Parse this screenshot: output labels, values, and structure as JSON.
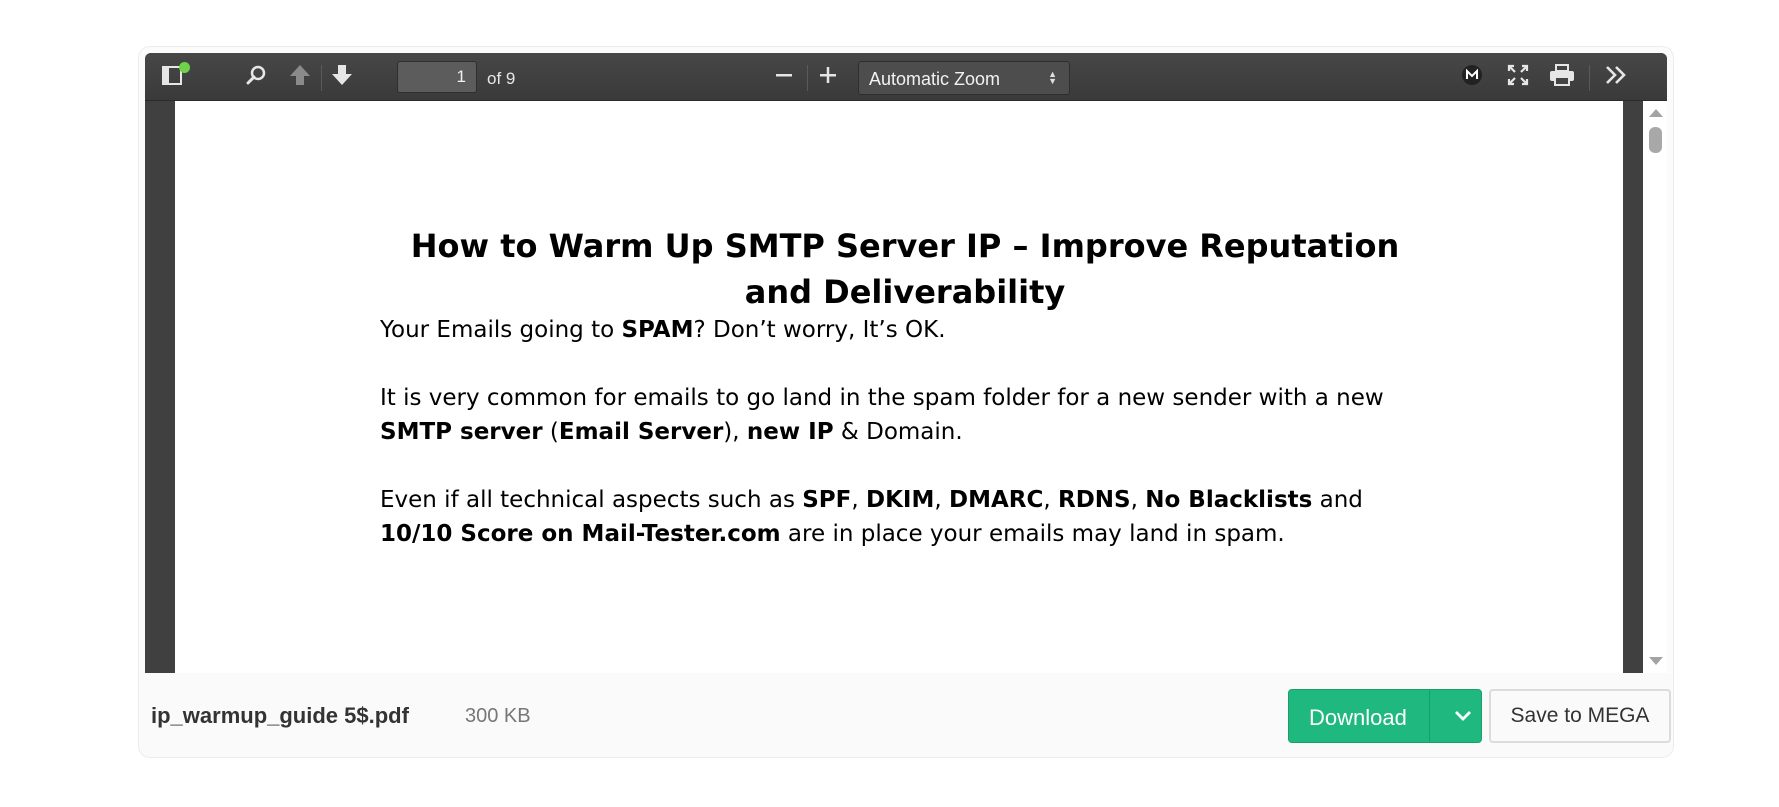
{
  "toolbar": {
    "page_number": "1",
    "page_of": "of 9",
    "zoom_value": "Automatic Zoom"
  },
  "icons": {
    "sidebar": "sidebar-toggle-icon",
    "search": "search-icon",
    "prev": "arrow-up-icon",
    "next": "arrow-down-icon",
    "zoom_out": "minus-icon",
    "zoom_in": "plus-icon",
    "mega": "mega-logo-icon",
    "fullscreen": "fullscreen-icon",
    "print": "print-icon",
    "more": "double-chevron-right-icon"
  },
  "colors": {
    "toolbar_bg": "#404040",
    "download_green": "#1fb87f",
    "notification_dot": "#6fd34a"
  },
  "document": {
    "title": "How to Warm Up SMTP Server IP – Improve Reputation and Deliverability",
    "p1": {
      "t1": "Your Emails going to ",
      "b1": "SPAM",
      "t2": "? Don’t worry, It’s OK."
    },
    "p2": {
      "t1": "It is very common for emails to go land in the spam folder for a new sender with a new ",
      "b1": "SMTP server",
      "t2": " (",
      "b2": "Email Server",
      "t3": "), ",
      "b3": "new IP",
      "t4": " & Domain."
    },
    "p3": {
      "t1": "Even if all technical aspects such as ",
      "b1": "SPF",
      "t2": ", ",
      "b2": "DKIM",
      "t3": ", ",
      "b3": "DMARC",
      "t4": ", ",
      "b4": "RDNS",
      "t5": ", ",
      "b5": "No Blacklists",
      "t6": " and ",
      "b6": "10/10 Score on Mail-Tester.com",
      "t7": " are in place your emails may land in spam."
    }
  },
  "footer": {
    "filename": "ip_warmup_guide 5$.pdf",
    "filesize": "300 KB",
    "download_label": "Download",
    "save_label": "Save to MEGA"
  }
}
